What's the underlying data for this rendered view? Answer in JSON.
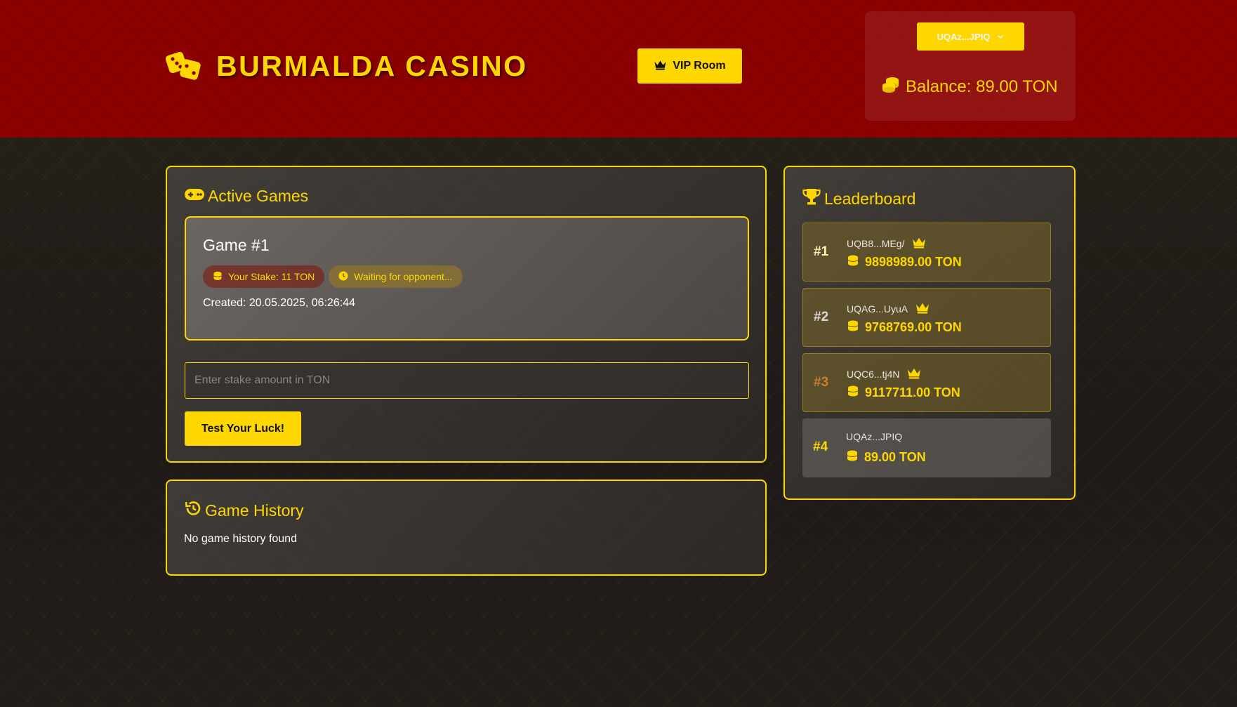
{
  "header": {
    "logo_text": "BURMALDA CASINO",
    "vip_label": "VIP Room",
    "wallet_label": "UQAz...JPIQ",
    "balance_text": "Balance: 89.00 TON"
  },
  "active_games": {
    "title": "Active Games",
    "games": [
      {
        "title": "Game #1",
        "stake_badge": "Your Stake: 11 TON",
        "status_badge": "Waiting for opponent...",
        "created": "Created: 20.05.2025, 06:26:44"
      }
    ],
    "stake_placeholder": "Enter stake amount in TON",
    "play_button": "Test Your Luck!"
  },
  "history": {
    "title": "Game History",
    "empty_text": "No game history found"
  },
  "leaderboard": {
    "title": "Leaderboard",
    "entries": [
      {
        "rank": "#1",
        "address": "UQB8...MEg/",
        "amount": "9898989.00 TON"
      },
      {
        "rank": "#2",
        "address": "UQAG...UyuA",
        "amount": "9768769.00 TON"
      },
      {
        "rank": "#3",
        "address": "UQC6...tj4N",
        "amount": "9117711.00 TON"
      },
      {
        "rank": "#4",
        "address": "UQAz...JPIQ",
        "amount": "89.00 TON"
      }
    ]
  },
  "colors": {
    "accent": "#ffd700",
    "header_bg": "#8b0000",
    "rank_gold": "#ffd700",
    "rank_silver": "#d9d9d9",
    "rank_bronze": "#cd7f32"
  },
  "icons": [
    "dice-icon",
    "crown-icon",
    "chevron-down-icon",
    "coins-icon",
    "gamepad-icon",
    "clock-icon",
    "history-icon",
    "trophy-icon"
  ]
}
